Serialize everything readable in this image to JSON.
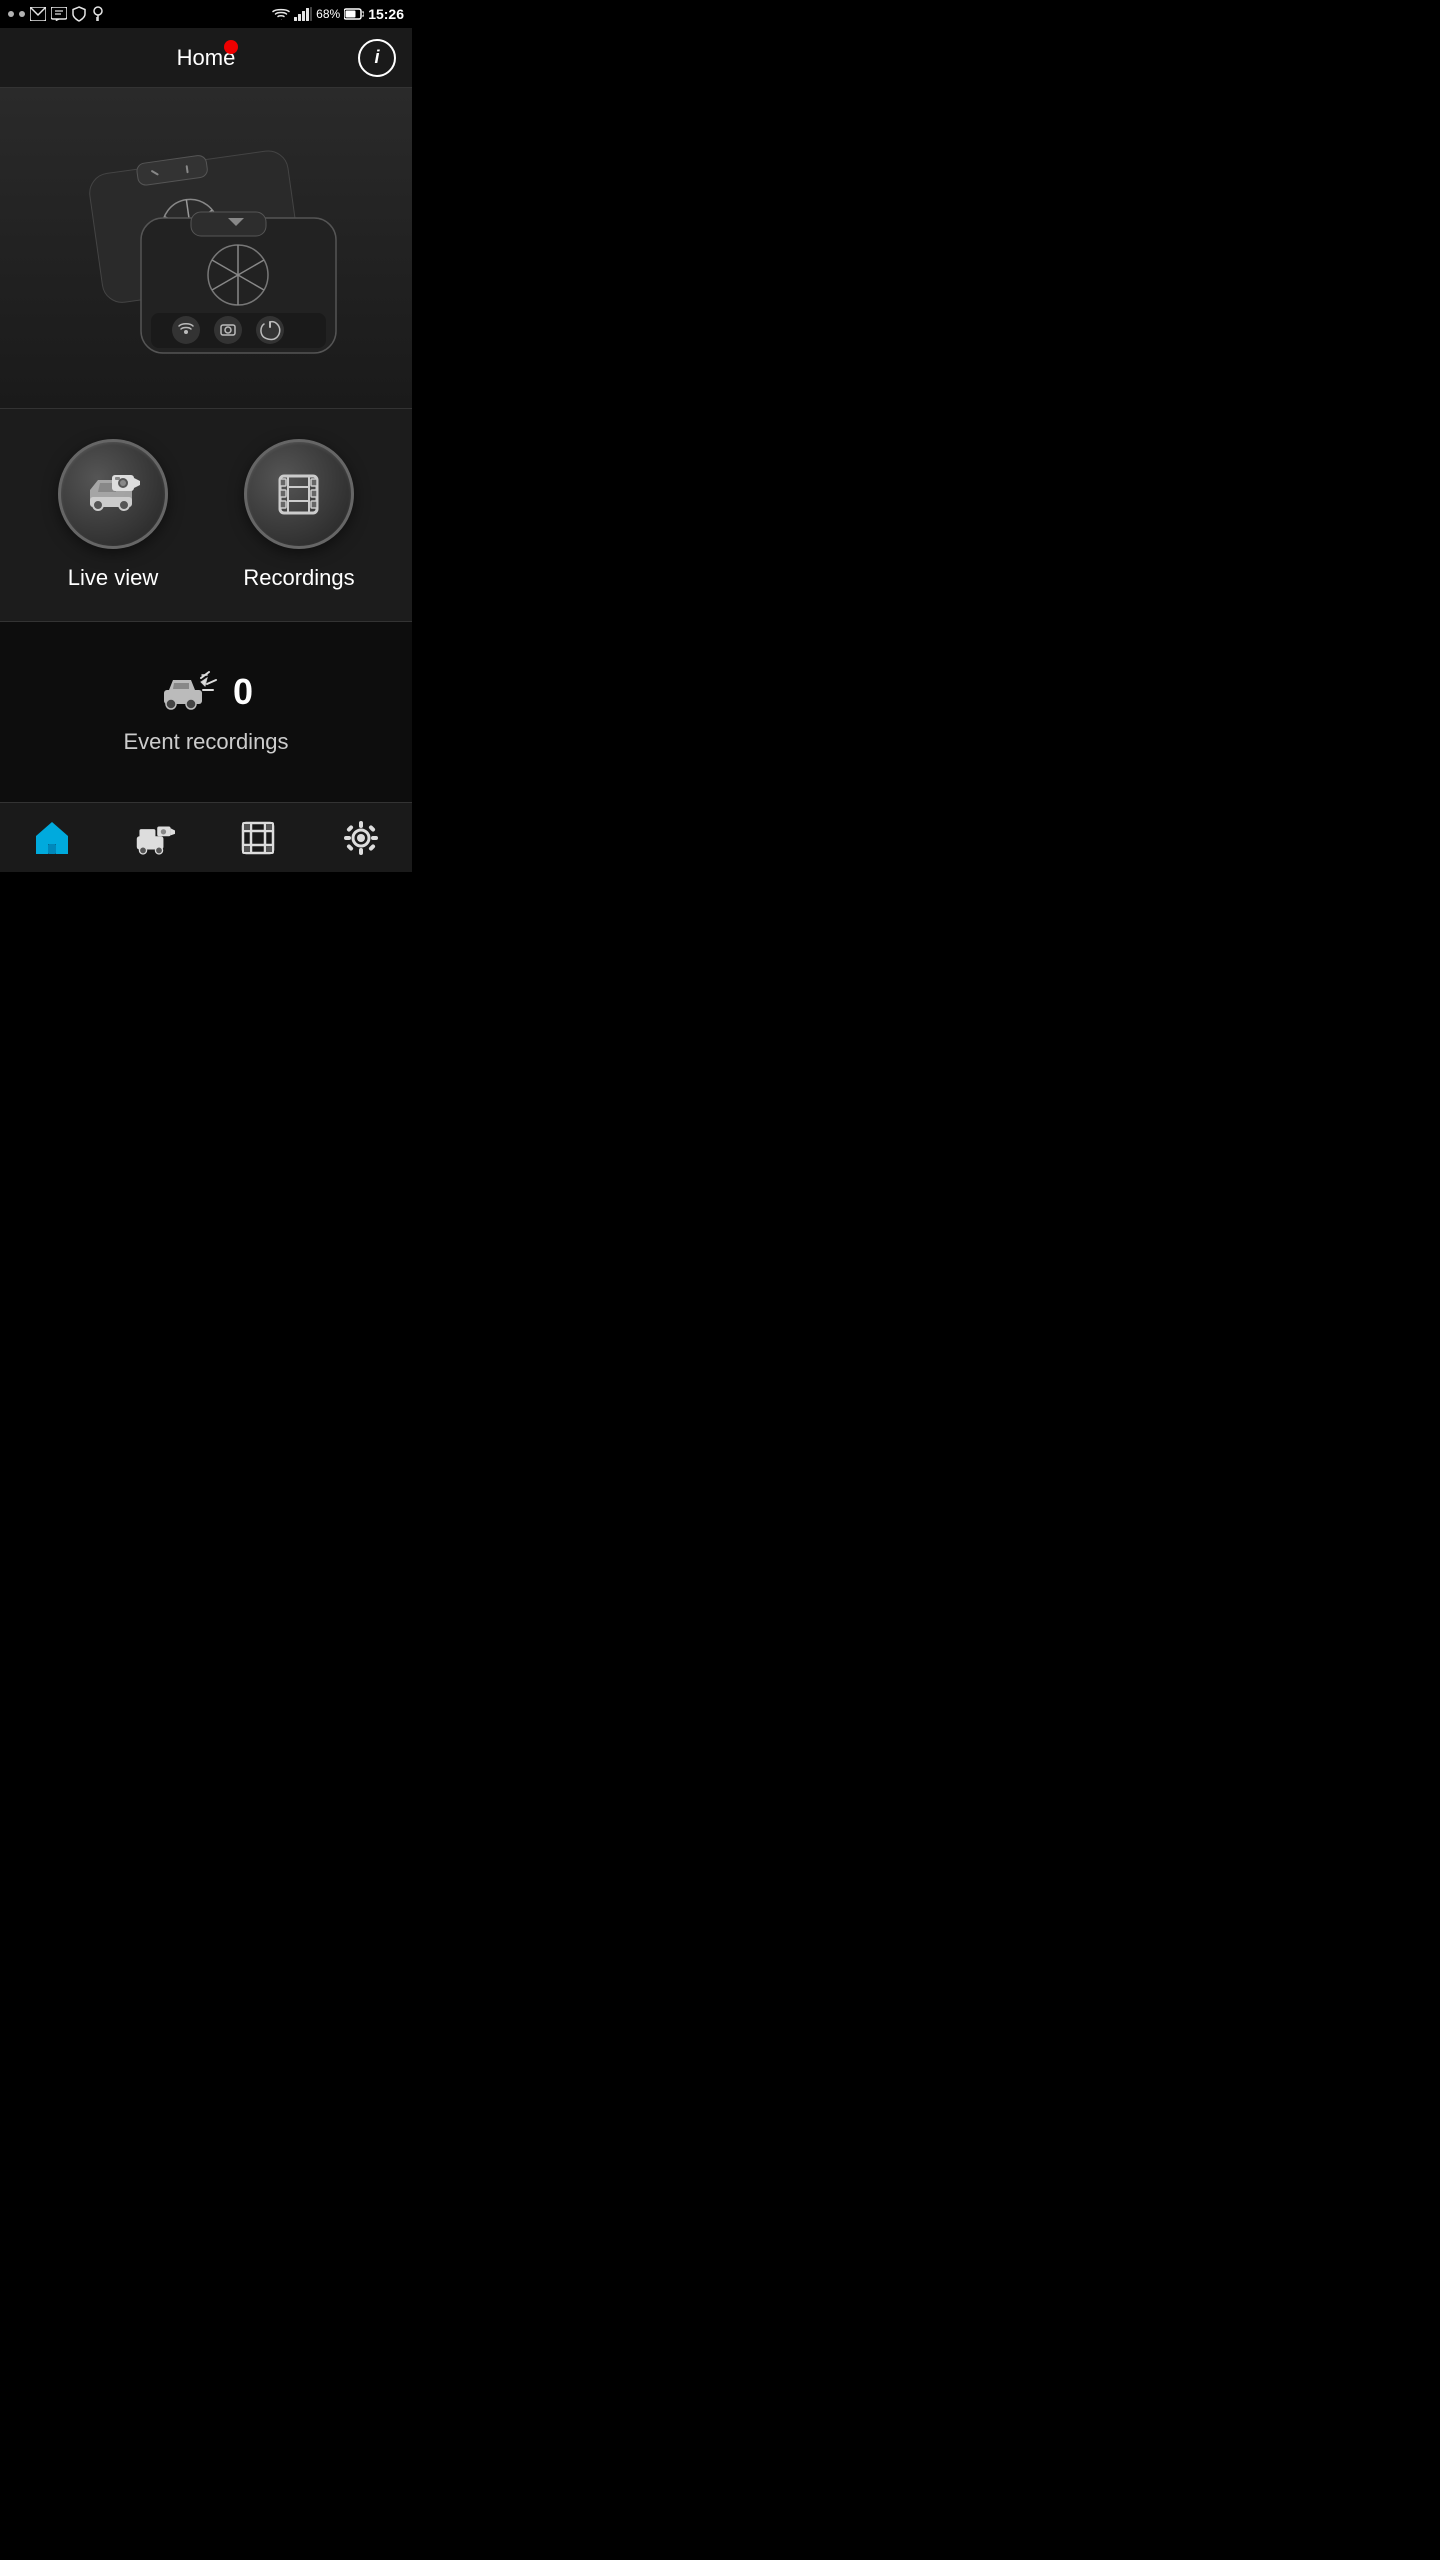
{
  "statusBar": {
    "battery": "68%",
    "time": "15:26"
  },
  "header": {
    "title": "Home",
    "infoLabel": "i"
  },
  "buttons": {
    "liveViewLabel": "Live view",
    "recordingsLabel": "Recordings"
  },
  "eventSection": {
    "count": "0",
    "label": "Event recordings"
  },
  "bottomNav": {
    "homeLabel": "Home",
    "liveLabel": "Live",
    "recordingsLabel": "Recordings",
    "settingsLabel": "Settings"
  }
}
